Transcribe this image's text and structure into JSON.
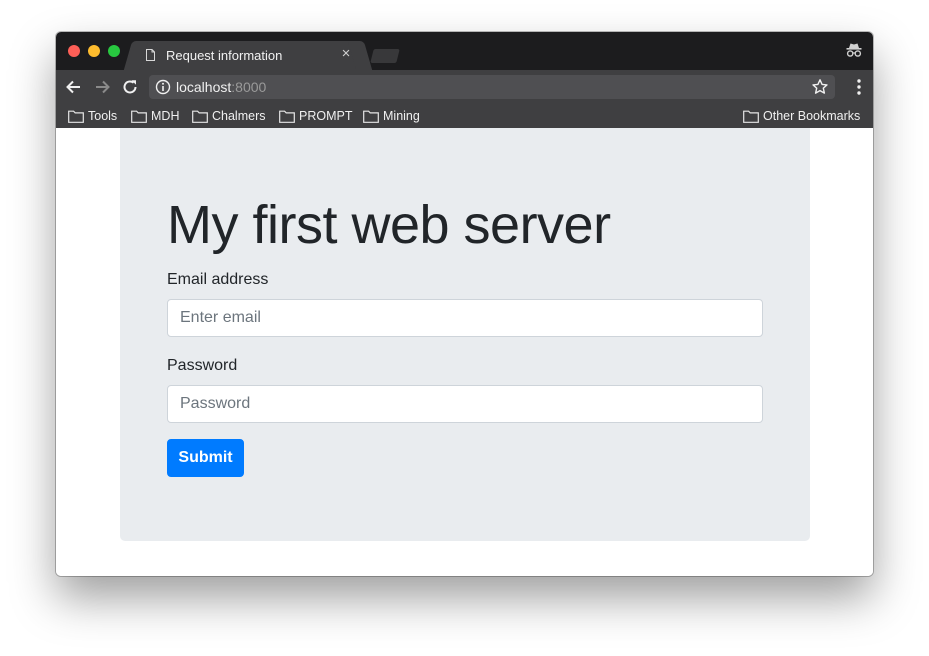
{
  "browser": {
    "tab_title": "Request information",
    "tab_close_glyph": "×",
    "address": {
      "host": "localhost",
      "port": ":8000"
    },
    "icons": {
      "tab": "document-icon",
      "incognito": "incognito-icon",
      "back": "back-arrow-icon",
      "forward": "forward-arrow-icon",
      "reload": "reload-icon",
      "info": "info-icon",
      "star": "star-icon",
      "menu": "menu-icon",
      "folder": "folder-icon"
    }
  },
  "bookmarks": {
    "items": [
      {
        "label": "Tools"
      },
      {
        "label": "MDH"
      },
      {
        "label": "Chalmers"
      },
      {
        "label": "PROMPT"
      },
      {
        "label": "Mining"
      }
    ],
    "other": "Other Bookmarks"
  },
  "page": {
    "heading": "My first web server",
    "email_label": "Email address",
    "email_placeholder": "Enter email",
    "password_label": "Password",
    "password_placeholder": "Password",
    "submit_label": "Submit"
  },
  "colors": {
    "jumbotron": "#e9ecef",
    "primary": "#007bff",
    "chrome_dark": "#1c1c1e",
    "chrome_toolbar": "#3f3f41"
  }
}
